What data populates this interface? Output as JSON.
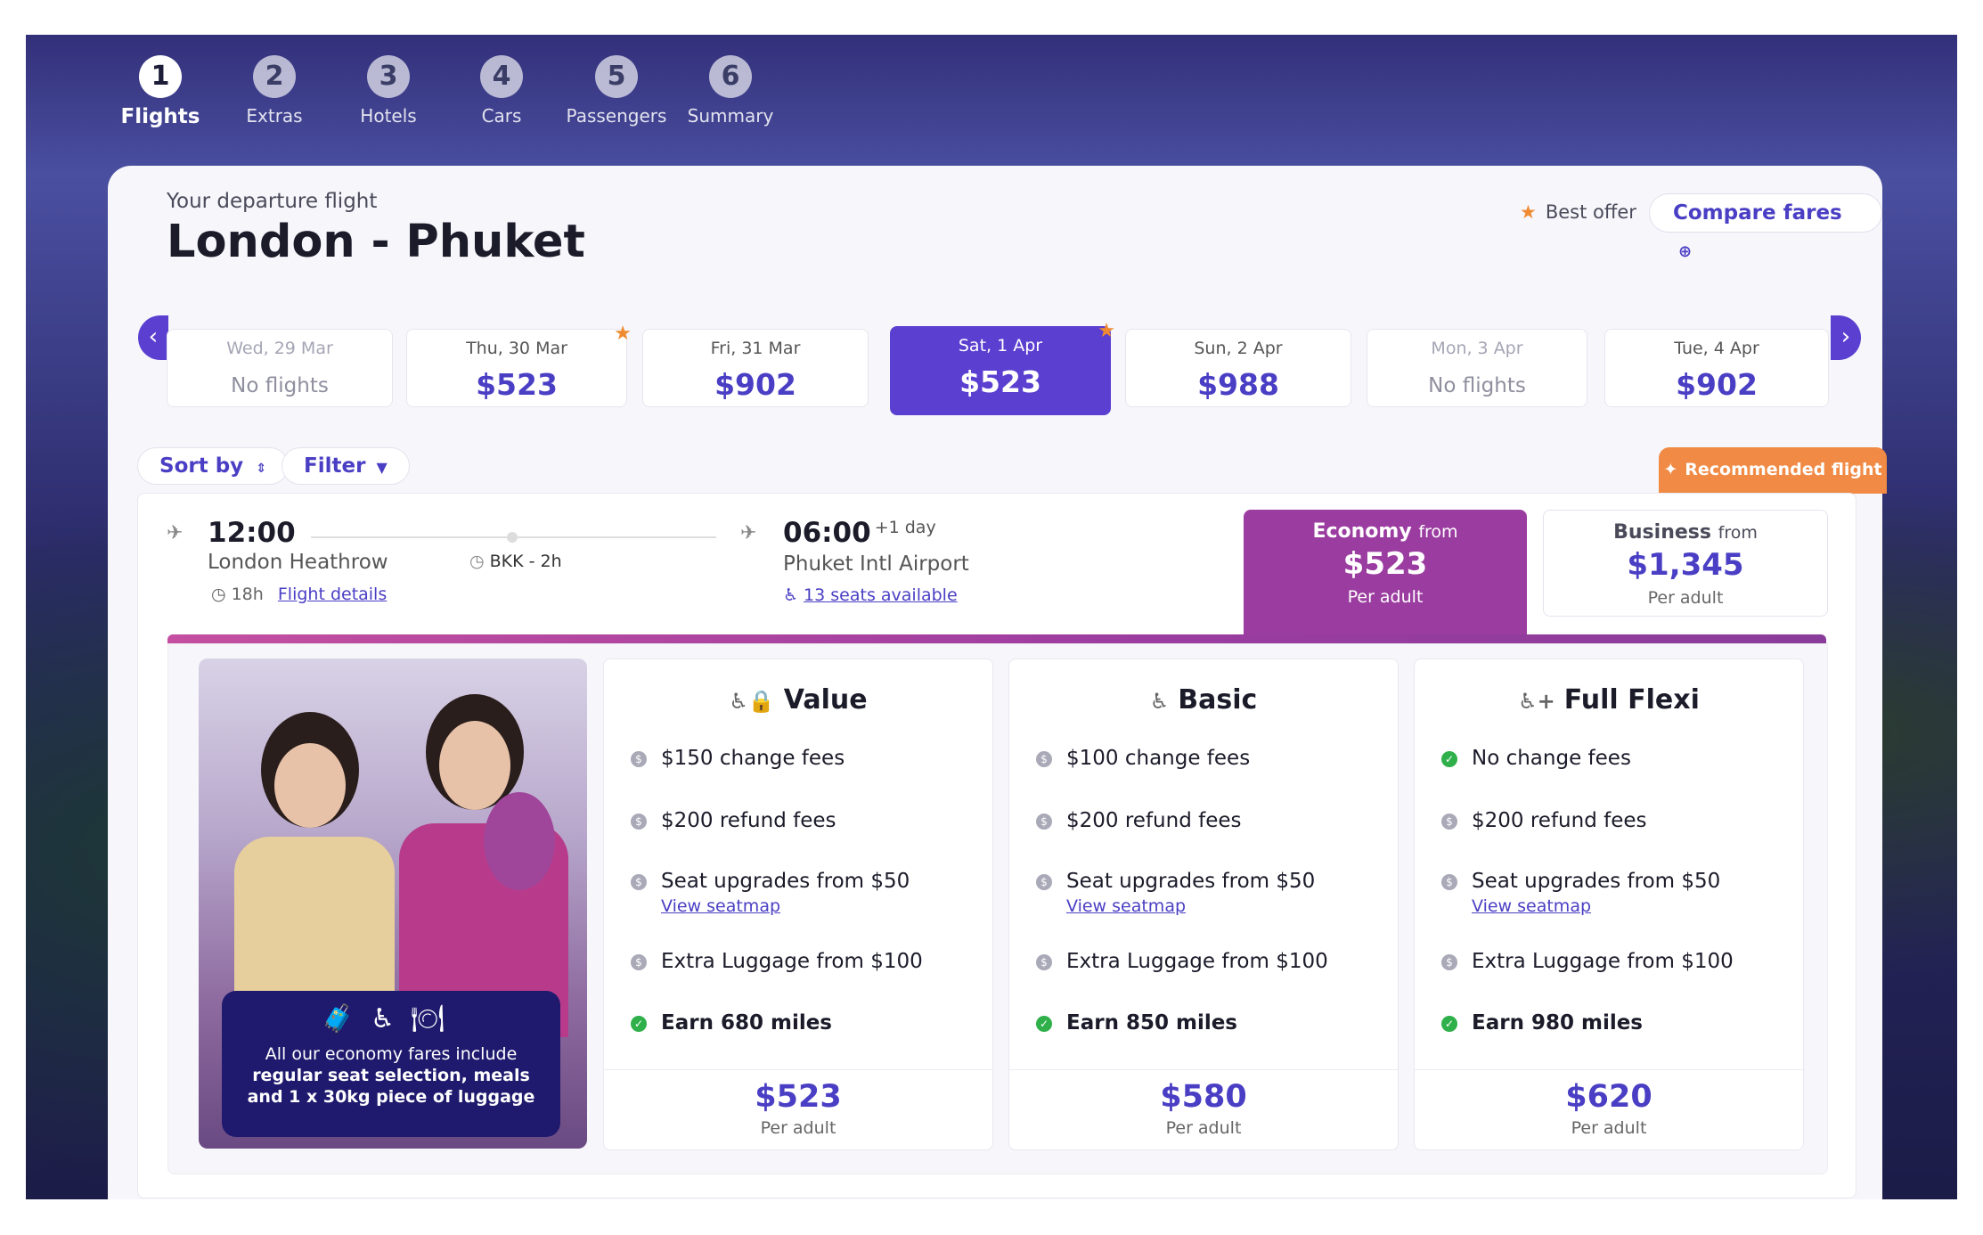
{
  "steps": [
    {
      "num": "1",
      "label": "Flights"
    },
    {
      "num": "2",
      "label": "Extras"
    },
    {
      "num": "3",
      "label": "Hotels"
    },
    {
      "num": "4",
      "label": "Cars"
    },
    {
      "num": "5",
      "label": "Passengers"
    },
    {
      "num": "6",
      "label": "Summary"
    }
  ],
  "header": {
    "subtitle": "Your departure flight",
    "title": "London - Phuket",
    "best_offer": "Best offer",
    "compare": "Compare fares"
  },
  "dates": [
    {
      "label": "Wed, 29 Mar",
      "price": "No flights"
    },
    {
      "label": "Thu, 30 Mar",
      "price": "$523"
    },
    {
      "label": "Fri, 31 Mar",
      "price": "$902"
    },
    {
      "label": "Sat, 1 Apr",
      "price": "$523"
    },
    {
      "label": "Sun, 2 Apr",
      "price": "$988"
    },
    {
      "label": "Mon, 3 Apr",
      "price": "No flights"
    },
    {
      "label": "Tue, 4 Apr",
      "price": "$902"
    }
  ],
  "toolbar": {
    "sort": "Sort by",
    "filter": "Filter",
    "recommended": "Recommended flight"
  },
  "flight": {
    "dep_time": "12:00",
    "dep_airport": "London Heathrow",
    "duration": "18h",
    "details_link": "Flight details",
    "stop": "BKK - 2h",
    "arr_time": "06:00",
    "arr_offset": "+1 day",
    "arr_airport": "Phuket Intl Airport",
    "seats": "13 seats available"
  },
  "fares": {
    "economy": {
      "name": "Economy",
      "from": "from",
      "price": "$523",
      "per": "Per adult"
    },
    "business": {
      "name": "Business",
      "from": "from",
      "price": "$1,345",
      "per": "Per adult"
    }
  },
  "promo": {
    "text_plain": "All our economy fares include",
    "text_bold": "regular seat selection, meals and 1 x 30kg piece of luggage"
  },
  "options": [
    {
      "name": "Value",
      "icon": "seat-lock-icon",
      "features": [
        "$150 change fees",
        "$200 refund fees",
        "Seat upgrades from $50",
        "Extra Luggage from $100",
        "Earn 680 miles"
      ],
      "seatmap": "View seatmap",
      "price": "$523",
      "per": "Per adult"
    },
    {
      "name": "Basic",
      "icon": "seat-icon",
      "features": [
        "$100 change fees",
        "$200 refund fees",
        "Seat upgrades from $50",
        "Extra Luggage from $100",
        "Earn 850 miles"
      ],
      "seatmap": "View seatmap",
      "price": "$580",
      "per": "Per adult"
    },
    {
      "name": "Full Flexi",
      "icon": "seat-plus-icon",
      "features": [
        "No change fees",
        "$200 refund fees",
        "Seat upgrades from $50",
        "Extra Luggage from $100",
        "Earn 980 miles"
      ],
      "seatmap": "View seatmap",
      "price": "$620",
      "per": "Per adult"
    }
  ],
  "colors": {
    "accent": "#5a3fd0",
    "economy": "#9b3ca0",
    "recommended": "#f08a44",
    "ok": "#2fb04a"
  }
}
